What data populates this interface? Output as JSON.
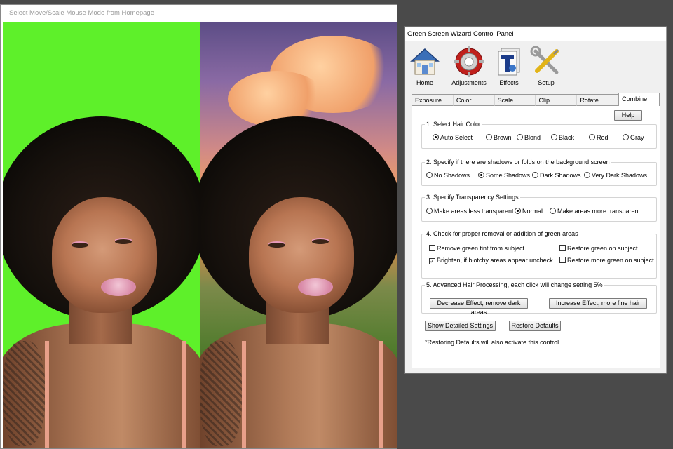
{
  "image_window": {
    "title": "Select Move/Scale Mouse Mode from Homepage"
  },
  "panel": {
    "title": "Green Screen Wizard Control Panel",
    "toolbar": [
      {
        "label": "Home",
        "icon": "home-icon"
      },
      {
        "label": "Adjustments",
        "icon": "gear-icon"
      },
      {
        "label": "Effects",
        "icon": "effects-icon"
      },
      {
        "label": "Setup",
        "icon": "tools-icon"
      }
    ],
    "tabs": [
      "Exposure",
      "Color",
      "Scale",
      "Clip",
      "Rotate",
      "Combine"
    ],
    "active_tab": "Combine",
    "help_label": "Help",
    "hair_color": {
      "title": "1. Select Hair Color",
      "options": [
        "Auto Select",
        "Brown",
        "Blond",
        "Black",
        "Red",
        "Gray"
      ],
      "selected": "Auto Select"
    },
    "shadows": {
      "title": "2. Specify if there are shadows or folds on the background screen",
      "options": [
        "No Shadows",
        "Some Shadows",
        "Dark Shadows",
        "Very Dark Shadows"
      ],
      "selected": "Some Shadows"
    },
    "transparency": {
      "title": "3. Specify Transparency Settings",
      "options": [
        "Make areas less transparent",
        "Normal",
        "Make areas more transparent"
      ],
      "selected": "Normal"
    },
    "green_areas": {
      "title": "4. Check for proper removal or addition of green areas",
      "checks": [
        {
          "label": "Remove green tint from subject",
          "checked": false
        },
        {
          "label": "Restore green on subject",
          "checked": false
        },
        {
          "label": "Brighten,  if blotchy areas appear uncheck",
          "checked": true
        },
        {
          "label": "Restore more green on subject",
          "checked": false
        }
      ]
    },
    "hair_processing": {
      "title": "5. Advanced Hair Processing, each click will change setting 5%",
      "decrease_label": "Decrease Effect, remove dark areas",
      "increase_label": "Increase Effect, more fine hair"
    },
    "show_detailed_label": "Show Detailed Settings",
    "restore_defaults_label": "Restore Defaults",
    "restore_note": "*Restoring Defaults will also activate this control"
  }
}
